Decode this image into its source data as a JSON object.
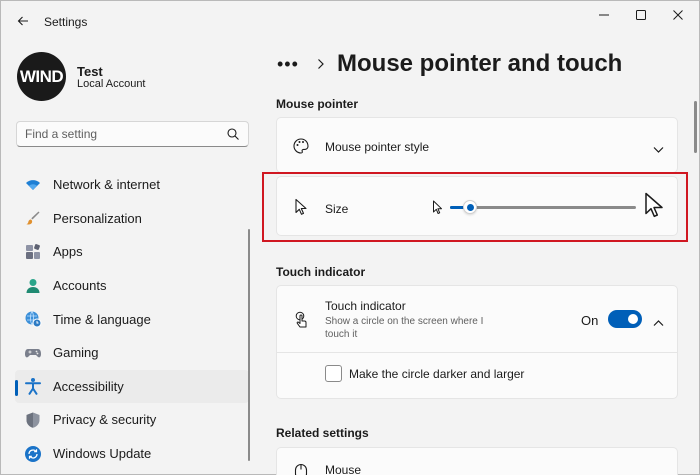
{
  "window": {
    "app_title": "Settings",
    "back_icon": "back-arrow-icon",
    "controls": [
      "minimize-icon",
      "maximize-icon",
      "close-icon"
    ]
  },
  "profile": {
    "avatar_text": "WIND",
    "name": "Test",
    "account_type": "Local Account"
  },
  "search": {
    "placeholder": "Find a setting",
    "value": "",
    "icon": "search-icon"
  },
  "sidebar": {
    "items": [
      {
        "label": "Network & internet",
        "icon": "wifi-icon",
        "active": false
      },
      {
        "label": "Personalization",
        "icon": "brush-icon",
        "active": false
      },
      {
        "label": "Apps",
        "icon": "apps-icon",
        "active": false
      },
      {
        "label": "Accounts",
        "icon": "person-icon",
        "active": false
      },
      {
        "label": "Time & language",
        "icon": "globe-clock-icon",
        "active": false
      },
      {
        "label": "Gaming",
        "icon": "gamepad-icon",
        "active": false
      },
      {
        "label": "Accessibility",
        "icon": "accessibility-icon",
        "active": true
      },
      {
        "label": "Privacy & security",
        "icon": "shield-icon",
        "active": false
      },
      {
        "label": "Windows Update",
        "icon": "update-icon",
        "active": false
      }
    ]
  },
  "header": {
    "more": "•••",
    "title": "Mouse pointer and touch"
  },
  "sections": {
    "mouse_pointer": "Mouse pointer",
    "touch_indicator": "Touch indicator",
    "related": "Related settings"
  },
  "mouse_pointer_style": {
    "label": "Mouse pointer style",
    "icon": "palette-icon",
    "expand_icon": "chevron-down-icon"
  },
  "size": {
    "label": "Size",
    "icon": "pointer-icon",
    "value_fraction": 0.11,
    "min_icon": "small-pointer-icon",
    "max_icon": "large-pointer-icon"
  },
  "touch": {
    "label": "Touch indicator",
    "description_line1": "Show a circle on the screen where I",
    "description_line2": "touch it",
    "icon": "touch-icon",
    "toggle_label": "On",
    "toggle_on": true,
    "collapse_icon": "chevron-up-icon",
    "option_label": "Make the circle darker and larger",
    "option_checked": false
  },
  "related": {
    "mouse_label": "Mouse",
    "mouse_icon": "mouse-icon"
  },
  "colors": {
    "accent": "#005fb8",
    "highlight_border": "#d01721",
    "background": "#f3f3f3",
    "card": "#fbfbfb"
  }
}
